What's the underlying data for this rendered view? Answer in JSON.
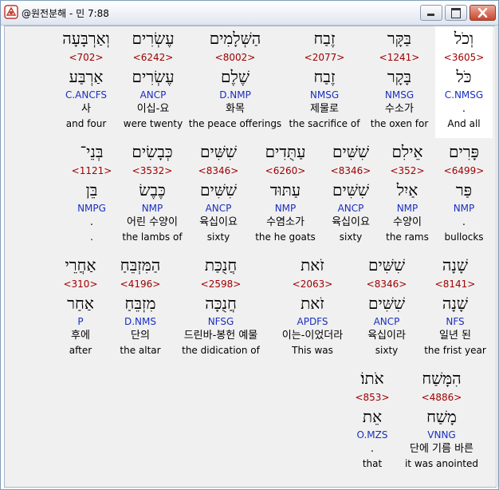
{
  "window": {
    "title": "@원전분해 - 민 7:88"
  },
  "controls": {
    "minimize_icon": "minimize-icon",
    "maximize_icon": "maximize-icon",
    "close_icon": "close-icon"
  },
  "rows": [
    {
      "words": [
        {
          "hebrew": "וְכֹל",
          "strong": "<3605>",
          "lemma": "כֹּל",
          "parse": "C.NMSG",
          "korean": ".",
          "english": "And all",
          "highlight": true
        },
        {
          "hebrew": "בַּקָּר",
          "strong": "<1241>",
          "lemma": "בָּקָר",
          "parse": "NMSG",
          "korean": "수소가",
          "english": "the oxen for"
        },
        {
          "hebrew": "זֶבַח",
          "strong": "<2077>",
          "lemma": "זֶבַח",
          "parse": "NMSG",
          "korean": "제물로",
          "english": "the sacrifice of"
        },
        {
          "hebrew": "הַשְּׁלָמִים",
          "strong": "<8002>",
          "lemma": "שֶׁלֶם",
          "parse": "D.NMP",
          "korean": "화목",
          "english": "the peace offerings"
        },
        {
          "hebrew": "עֶשְׂרִים",
          "strong": "<6242>",
          "lemma": "עֶשְׂרִים",
          "parse": "ANCP",
          "korean": "이십-요",
          "english": "were twenty"
        },
        {
          "hebrew": "וְאַרְבָּעָה",
          "strong": "<702>",
          "lemma": "אַרְבַּע",
          "parse": "C.ANCFS",
          "korean": "사",
          "english": "and four"
        }
      ]
    },
    {
      "words": [
        {
          "hebrew": "פָּרִים",
          "strong": "<6499>",
          "lemma": "פַּר",
          "parse": "NMP",
          "korean": ".",
          "english": "bullocks"
        },
        {
          "hebrew": "אֵילִם",
          "strong": "<352>",
          "lemma": "אַיִל",
          "parse": "NMP",
          "korean": "수양이",
          "english": "the rams"
        },
        {
          "hebrew": "שִׁשִּׁים",
          "strong": "<8346>",
          "lemma": "שִׁשִּׁים",
          "parse": "ANCP",
          "korean": "육십이요",
          "english": "sixty"
        },
        {
          "hebrew": "עַתֻּדִים",
          "strong": "<6260>",
          "lemma": "עַתּוּד",
          "parse": "NMP",
          "korean": "수염소가",
          "english": "the he goats"
        },
        {
          "hebrew": "שִׁשִּׁים",
          "strong": "<8346>",
          "lemma": "שִׁשִּׁים",
          "parse": "ANCP",
          "korean": "육십이요",
          "english": "sixty"
        },
        {
          "hebrew": "כְּבָשִׂים",
          "strong": "<3532>",
          "lemma": "כֶּבֶשׂ",
          "parse": "NMP",
          "korean": "어린 수양이",
          "english": "the lambs of"
        },
        {
          "hebrew": "בְּנֵי־",
          "strong": "<1121>",
          "lemma": "בֵּן",
          "parse": "NMPG",
          "korean": ".",
          "english": "."
        }
      ]
    },
    {
      "words": [
        {
          "hebrew": "שָׁנָה",
          "strong": "<8141>",
          "lemma": "שָׁנָה",
          "parse": "NFS",
          "korean": "일년 된",
          "english": "the frist year"
        },
        {
          "hebrew": "שִׁשִּׁים",
          "strong": "<8346>",
          "lemma": "שִׁשִּׁים",
          "parse": "ANCP",
          "korean": "육십이라",
          "english": "sixty"
        },
        {
          "hebrew": "זֹאת",
          "strong": "<2063>",
          "lemma": "זֹאת",
          "parse": "APDFS",
          "korean": "이는-이었더라",
          "english": "This was"
        },
        {
          "hebrew": "חֲנֻכַּת",
          "strong": "<2598>",
          "lemma": "חֲנֻכָּה",
          "parse": "NFSG",
          "korean": "드린바-봉헌 예물",
          "english": "the didication of"
        },
        {
          "hebrew": "הַמִּזְבֵּחַ",
          "strong": "<4196>",
          "lemma": "מִזְבֵּחַ",
          "parse": "D.NMS",
          "korean": "단의",
          "english": "the altar"
        },
        {
          "hebrew": "אַחֲרֵי",
          "strong": "<310>",
          "lemma": "אַחַר",
          "parse": "P",
          "korean": "후에",
          "english": "after"
        }
      ]
    },
    {
      "words": [
        {
          "hebrew": "הִמָּשַׁח",
          "strong": "<4886>",
          "lemma": "מָשַׁח",
          "parse": "VNNG",
          "korean": "단에 기름 바른",
          "english": "it was anointed"
        },
        {
          "hebrew": "אֹתוֹ׃",
          "strong": "<853>",
          "lemma": "אֵת",
          "parse": "O.MZS",
          "korean": ".",
          "english": "that"
        }
      ]
    }
  ]
}
